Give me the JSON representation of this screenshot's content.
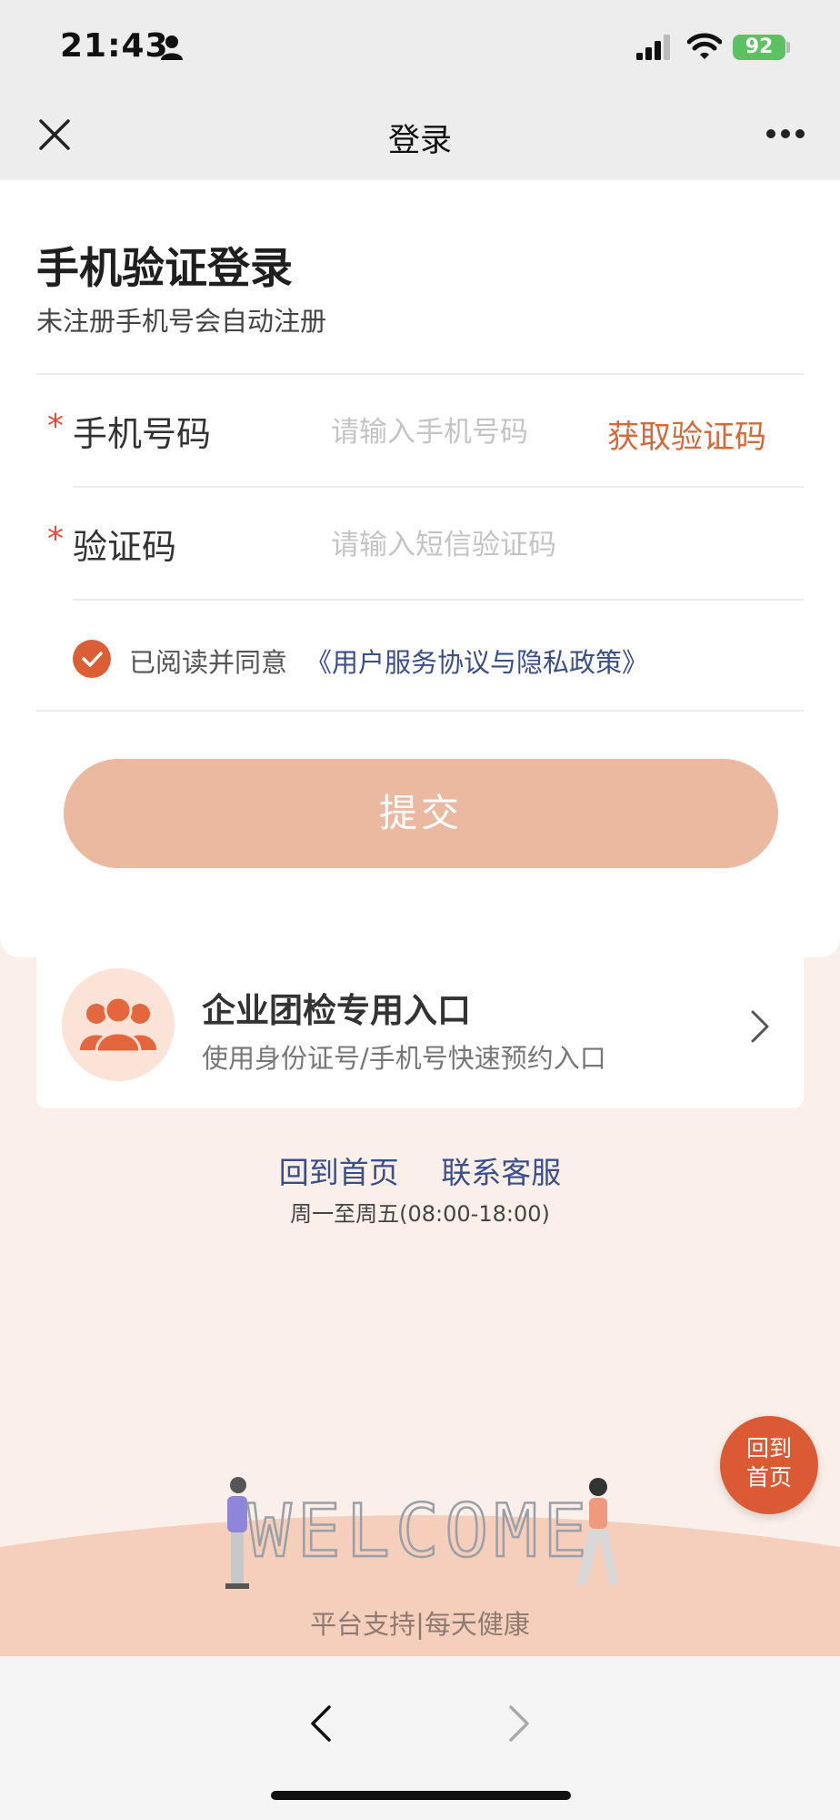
{
  "status_bar": {
    "time": "21:43",
    "battery": "92"
  },
  "nav": {
    "title": "登录"
  },
  "login": {
    "title": "手机验证登录",
    "subtitle": "未注册手机号会自动注册",
    "phone": {
      "required_mark": "*",
      "label": "手机号码",
      "placeholder": "请输入手机号码",
      "value": ""
    },
    "get_code": "获取验证码",
    "code": {
      "required_mark": "*",
      "label": "验证码",
      "placeholder": "请输入短信验证码",
      "value": ""
    },
    "agreement_checked": true,
    "agreement_prefix": "已阅读并同意",
    "agreement_link": "《用户服务协议与隐私政策》",
    "submit": "提交"
  },
  "enterprise": {
    "title": "企业团检专用入口",
    "subtitle": "使用身份证号/手机号快速预约入口"
  },
  "footer": {
    "home_link": "回到首页",
    "service_link": "联系客服",
    "service_hours": "周一至周五(08:00-18:00)"
  },
  "float_button": {
    "line1": "回到",
    "line2": "首页"
  },
  "banner": {
    "welcome_text": "WELCOME",
    "slogan": "平台支持|每天健康"
  },
  "colors": {
    "accent": "#dc5e35",
    "submit_bg": "#ebb8a0",
    "link": "#3a4e8a",
    "page_bg": "#fbefe9"
  }
}
